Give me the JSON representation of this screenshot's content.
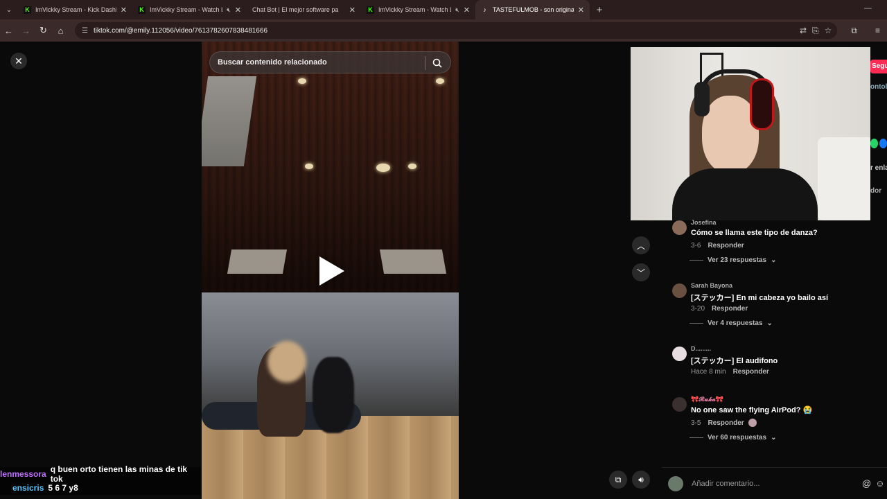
{
  "browser": {
    "tabs": [
      {
        "title": "ImVickky Stream - Kick Dashbo",
        "icon": "kick-icon",
        "muted": false,
        "active": false
      },
      {
        "title": "ImVickky Stream - Watch Li",
        "icon": "kick-icon",
        "muted": true,
        "active": false
      },
      {
        "title": "Chat Bot | El mejor software pa",
        "icon": "chatbot-icon",
        "muted": false,
        "active": false
      },
      {
        "title": "ImVickky Stream - Watch Li",
        "icon": "kick-icon",
        "muted": true,
        "active": false
      },
      {
        "title": "TASTEFULMOB - son original | T",
        "icon": "tiktok-icon",
        "muted": false,
        "active": true
      }
    ],
    "url": "tiktok.com/@emily.112056/video/7613782607838481666"
  },
  "player": {
    "search_placeholder": "Buscar contenido relacionado"
  },
  "stream_chat": [
    {
      "user": "lenmessora",
      "message": "q buen orto tienen las minas de tik tok"
    },
    {
      "user": "ensicris",
      "message": "5 6 7 y8"
    }
  ],
  "sidebar_peek": {
    "follow": "Segu",
    "user": "ontoliv",
    "share_label": "r enla",
    "extra": "dor"
  },
  "comments": [
    {
      "user": "Josefina",
      "text": "Cómo se llama este tipo de danza?",
      "date": "3-6",
      "reply": "Responder",
      "more": "Ver 23 respuestas"
    },
    {
      "user": "Sarah Bayona",
      "text": "[ステッカー] En mi cabeza yo bailo así",
      "date": "3-20",
      "reply": "Responder",
      "more": "Ver 4 respuestas"
    },
    {
      "user": "D.........",
      "text": "[ステッカー] El audifono",
      "date": "Hace 8 min",
      "reply": "Responder",
      "more": ""
    },
    {
      "user": "🎀𝓡𝓾𝓴𝓪🎀",
      "text": "No one saw the flying AirPod? 😭",
      "date": "3-5",
      "reply": "Responder",
      "more": "Ver 60 respuestas"
    }
  ],
  "composer": {
    "placeholder": "Añadir comentario..."
  },
  "colors": {
    "tabbar_bg": "#2b1d1d",
    "follow_button": "#fe2c55",
    "kick_green": "#53fc18"
  }
}
